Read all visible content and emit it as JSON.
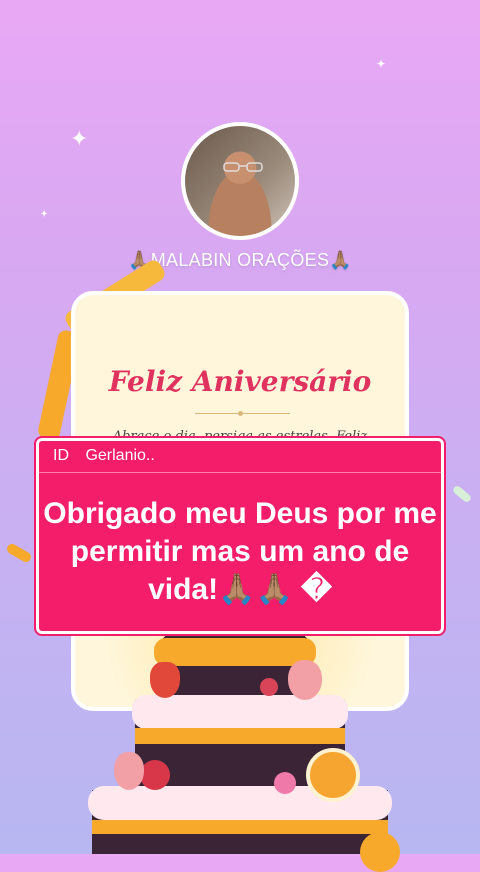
{
  "profile": {
    "username": "🙏🏽MALABIN ORAÇÕES🙏🏽"
  },
  "card": {
    "title": "Feliz Aniversário",
    "text": "Abrace o dia, persiga as estrelas. Feliz"
  },
  "caption": {
    "id_label": "ID",
    "name": "Gerlanio..",
    "message": "Obrigado meu Deus por me permitir mas um ano de vida!🙏🏽🙏🏽 �"
  },
  "colors": {
    "caption_bg": "#f31d6a",
    "card_title": "#e0325e",
    "ribbon": "#f6a92b",
    "cake_dark": "#3a2435"
  }
}
